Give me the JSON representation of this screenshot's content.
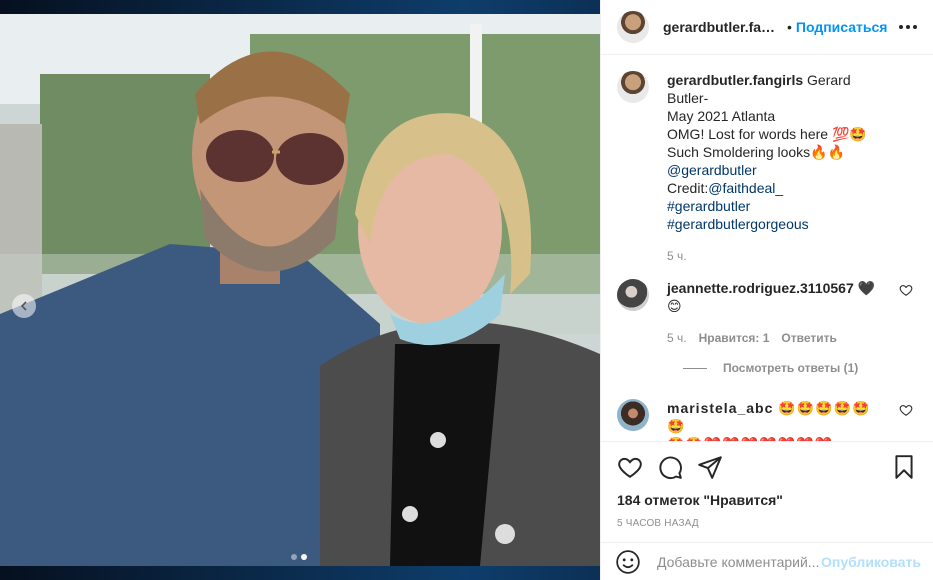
{
  "header": {
    "username": "gerardbutler.fangirl:",
    "separator": "•",
    "follow_label": "Подписаться",
    "more_icon": "more-horizontal-icon"
  },
  "caption": {
    "username": "gerardbutler.fangirls",
    "line1": "Gerard Butler-",
    "line2": "May 2021 Atlanta",
    "line3": "OMG! Lost for words here 💯🤩",
    "line4": "Such Smoldering looks🔥🔥",
    "mention": "@gerardbutler",
    "credit_prefix": "Credit:",
    "credit_mention": "@faithdeal_",
    "hashtag1": "#gerardbutler",
    "hashtag2": "#gerardbutlergorgeous",
    "time": "5 ч."
  },
  "comments": [
    {
      "username": "jeannette.rodriguez.3110567",
      "text": "🖤",
      "text2": "😊",
      "time": "5 ч.",
      "likes": "Нравится: 1",
      "reply_label": "Ответить",
      "view_replies": "Посмотреть ответы (1)"
    },
    {
      "username": "maristela_abc",
      "text": "🤩🤩🤩🤩🤩🤩",
      "text2": "🤩🤩❤️❤️❤️❤️❤️❤️❤️"
    }
  ],
  "actions": {
    "like_icon": "heart-icon",
    "comment_icon": "comment-icon",
    "share_icon": "share-icon",
    "save_icon": "bookmark-icon",
    "likes_text": "184 отметок \"Нравится\"",
    "timestamp": "5 часов назад"
  },
  "add_comment": {
    "placeholder": "Добавьте комментарий...",
    "post_label": "Опубликовать"
  },
  "carousel": {
    "dots": 2,
    "active": 1
  }
}
